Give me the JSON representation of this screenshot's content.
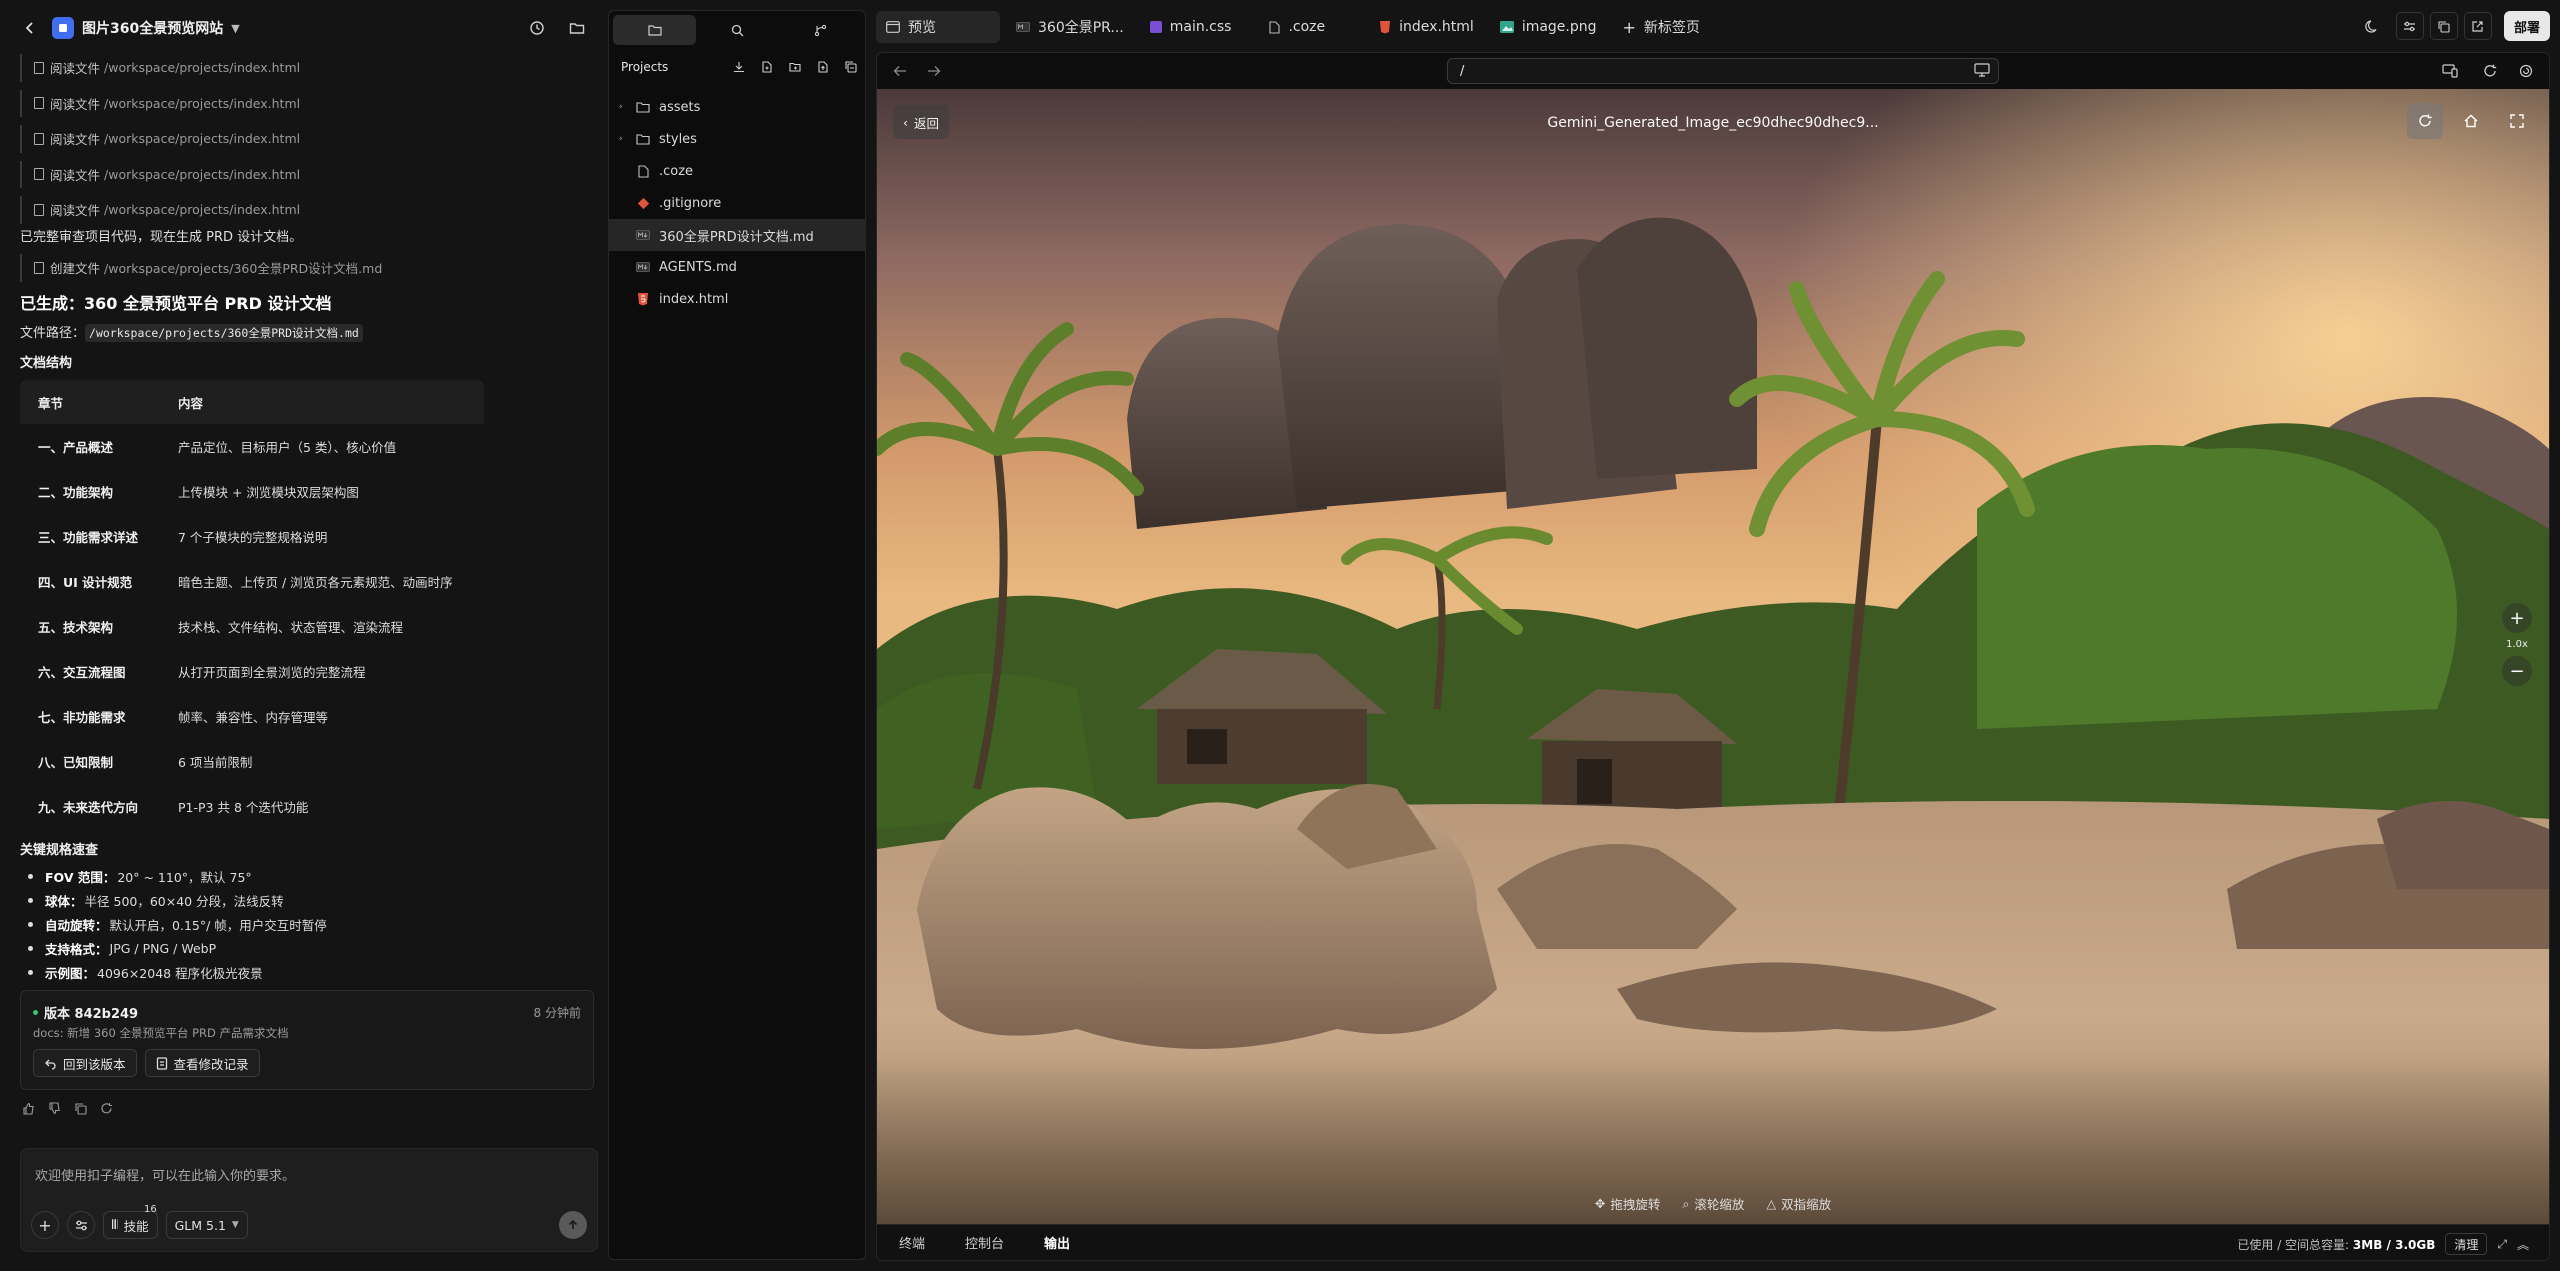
{
  "project": {
    "name": "图片360全景预览网站"
  },
  "file_ops": [
    {
      "verb": "阅读文件",
      "path": "/workspace/projects/index.html"
    },
    {
      "verb": "阅读文件",
      "path": "/workspace/projects/index.html"
    },
    {
      "verb": "阅读文件",
      "path": "/workspace/projects/index.html"
    },
    {
      "verb": "阅读文件",
      "path": "/workspace/projects/index.html"
    },
    {
      "verb": "阅读文件",
      "path": "/workspace/projects/index.html"
    }
  ],
  "chat": {
    "status_line": "已完整审查项目代码，现在生成 PRD 设计文档。",
    "create_op": {
      "verb": "创建文件",
      "path": "/workspace/projects/360全景PRD设计文档.md"
    },
    "heading": "已生成：360 全景预览平台 PRD 设计文档",
    "filepath_label": "文件路径：",
    "filepath_value": "/workspace/projects/360全景PRD设计文档.md",
    "structure_heading": "文档结构",
    "table": {
      "headers": [
        "章节",
        "内容"
      ],
      "rows": [
        [
          "一、产品概述",
          "产品定位、目标用户（5 类）、核心价值"
        ],
        [
          "二、功能架构",
          "上传模块 + 浏览模块双层架构图"
        ],
        [
          "三、功能需求详述",
          "7 个子模块的完整规格说明"
        ],
        [
          "四、UI 设计规范",
          "暗色主题、上传页 / 浏览页各元素规范、动画时序"
        ],
        [
          "五、技术架构",
          "技术栈、文件结构、状态管理、渲染流程"
        ],
        [
          "六、交互流程图",
          "从打开页面到全景浏览的完整流程"
        ],
        [
          "七、非功能需求",
          "帧率、兼容性、内存管理等"
        ],
        [
          "八、已知限制",
          "6 项当前限制"
        ],
        [
          "九、未来迭代方向",
          "P1-P3 共 8 个迭代功能"
        ]
      ]
    },
    "keys_heading": "关键规格速查",
    "keys": [
      {
        "k": "FOV 范围：",
        "v": "20° ~ 110°，默认 75°"
      },
      {
        "k": "球体：",
        "v": "半径 500，60×40 分段，法线反转"
      },
      {
        "k": "自动旋转：",
        "v": "默认开启，0.15°/ 帧，用户交互时暂停"
      },
      {
        "k": "支持格式：",
        "v": "JPG / PNG / WebP"
      },
      {
        "k": "示例图：",
        "v": "4096×2048 程序化极光夜景"
      }
    ],
    "version": {
      "title": "版本 842b249",
      "time": "8 分钟前",
      "desc": "docs: 新增 360 全景预览平台 PRD 产品需求文档",
      "btn_revert": "回到该版本",
      "btn_changes": "查看修改记录"
    },
    "input_placeholder": "欢迎使用扣子编程，可以在此输入你的要求。",
    "skills_label": "技能",
    "skills_count": "16",
    "model_label": "GLM 5.1"
  },
  "explorer": {
    "title": "Projects",
    "items": [
      {
        "name": "assets",
        "type": "folder"
      },
      {
        "name": "styles",
        "type": "folder"
      },
      {
        "name": ".coze",
        "type": "file"
      },
      {
        "name": ".gitignore",
        "type": "git"
      },
      {
        "name": "360全景PRD设计文档.md",
        "type": "md"
      },
      {
        "name": "AGENTS.md",
        "type": "md"
      },
      {
        "name": "index.html",
        "type": "html"
      }
    ]
  },
  "tabs": [
    {
      "label": "预览",
      "icon": "browser-icon"
    },
    {
      "label": "360全景PR...",
      "icon": "markdown-icon"
    },
    {
      "label": "main.css",
      "icon": "css-icon"
    },
    {
      "label": ".coze",
      "icon": "file-icon"
    },
    {
      "label": "index.html",
      "icon": "html-icon"
    },
    {
      "label": "image.png",
      "icon": "image-icon"
    },
    {
      "label": "新标签页",
      "icon": "plus-icon"
    }
  ],
  "deploy_label": "部署",
  "browser": {
    "url": "/"
  },
  "viewer": {
    "back_label": "返回",
    "title": "Gemini_Generated_Image_ec90dhec90dhec9...",
    "zoom_label": "1.0x",
    "hints": [
      "拖拽旋转",
      "滚轮缩放",
      "双指缩放"
    ]
  },
  "bottom": {
    "tabs": [
      "终端",
      "控制台",
      "输出"
    ],
    "storage_prefix": "已使用 / 空间总容量:",
    "storage_value": "3MB / 3.0GB",
    "clean_label": "清理"
  },
  "colors": {
    "accent": "#3f6ef0",
    "status_ok": "#3cc46e"
  }
}
